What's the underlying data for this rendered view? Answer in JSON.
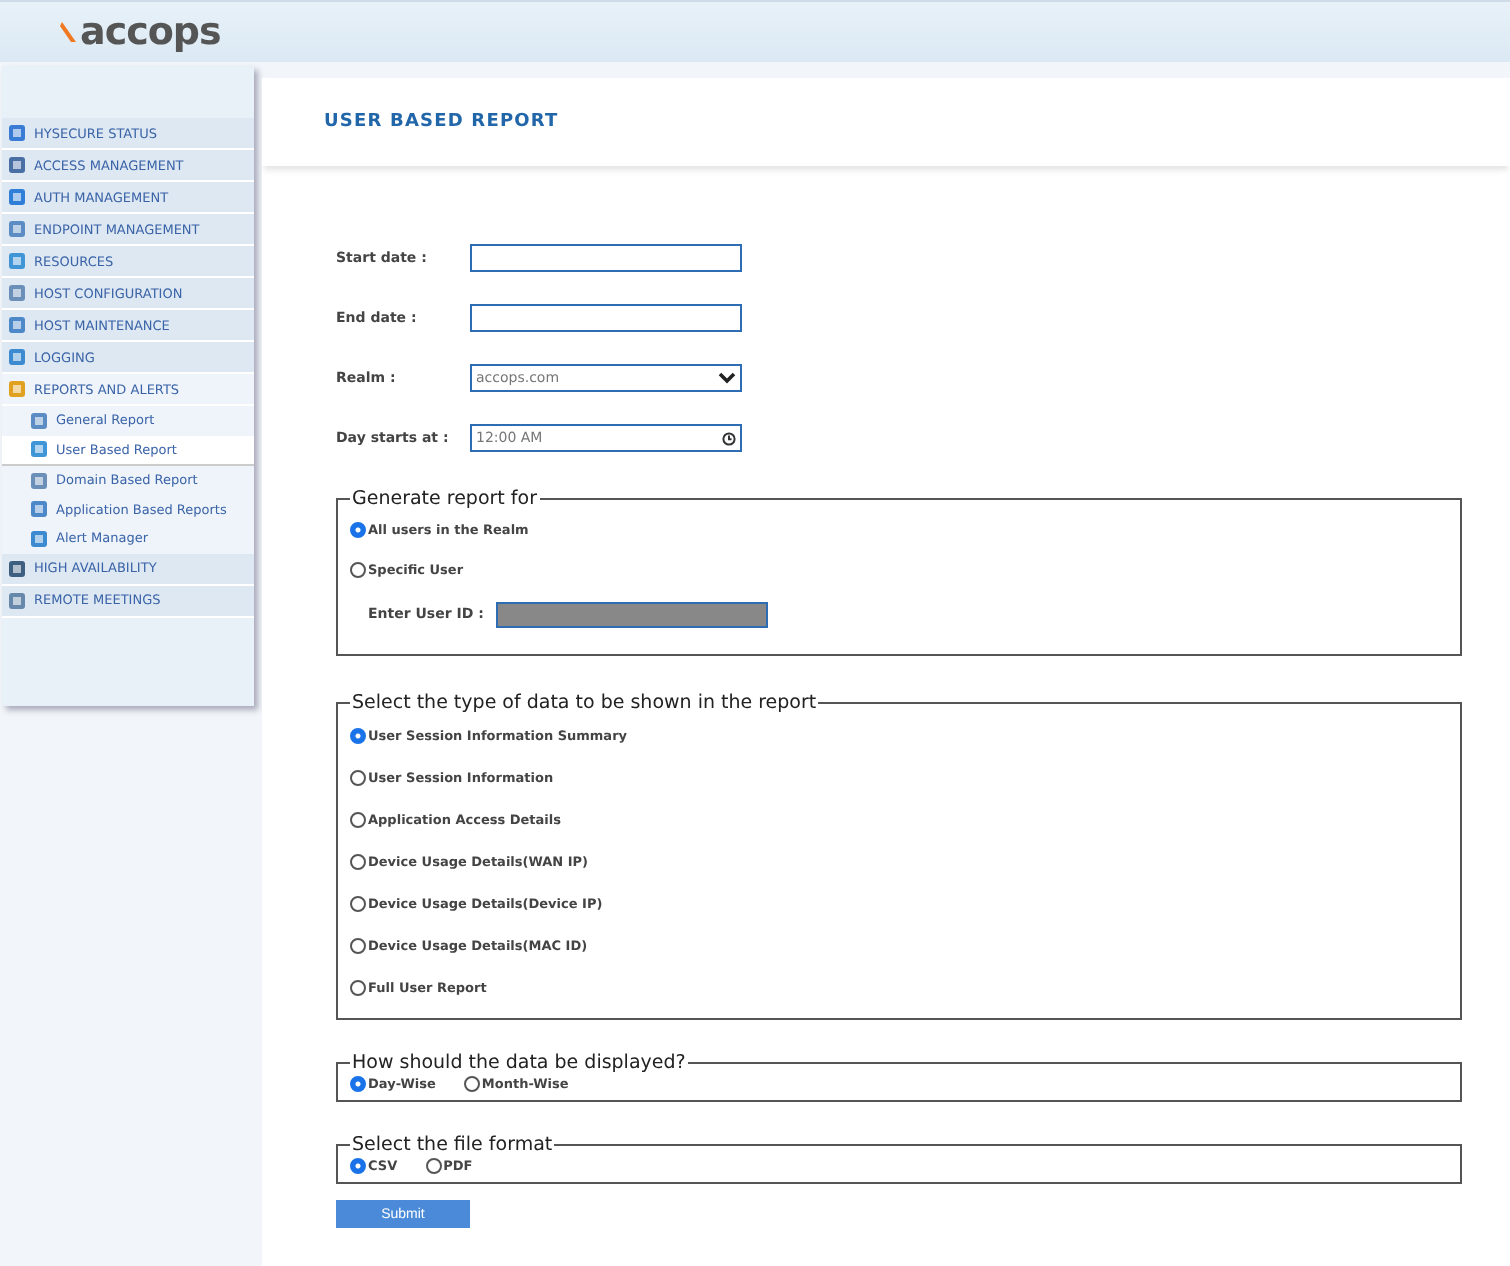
{
  "logo": "accops",
  "sidebar": {
    "items": [
      {
        "label": "HYSECURE STATUS",
        "expanded": false
      },
      {
        "label": "ACCESS MANAGEMENT",
        "expanded": false
      },
      {
        "label": "AUTH MANAGEMENT",
        "expanded": false
      },
      {
        "label": "ENDPOINT MANAGEMENT",
        "expanded": false
      },
      {
        "label": "RESOURCES",
        "expanded": false
      },
      {
        "label": "HOST CONFIGURATION",
        "expanded": false
      },
      {
        "label": "HOST MAINTENANCE",
        "expanded": false
      },
      {
        "label": "LOGGING",
        "expanded": false
      },
      {
        "label": "REPORTS AND ALERTS",
        "expanded": true,
        "children": [
          {
            "label": "General Report",
            "selected": false
          },
          {
            "label": "User Based Report",
            "selected": true
          },
          {
            "label": "Domain Based Report",
            "selected": false
          },
          {
            "label": "Application Based Reports",
            "selected": false
          },
          {
            "label": "Alert Manager",
            "selected": false
          }
        ]
      },
      {
        "label": "HIGH AVAILABILITY",
        "expanded": false
      },
      {
        "label": "REMOTE MEETINGS",
        "expanded": false
      }
    ]
  },
  "title": "USER BASED REPORT",
  "fields": [
    {
      "label": "Start date :",
      "kind": "text"
    },
    {
      "label": "End date :",
      "kind": "text"
    },
    {
      "label": "Realm :",
      "kind": "select",
      "value": "accops.com"
    },
    {
      "label": "Day starts at :",
      "kind": "time",
      "value": "12:00 AM"
    }
  ],
  "generate": {
    "legend": "Generate report for",
    "options": [
      {
        "label": "All users in the Realm",
        "selected": true
      },
      {
        "label": "Specific User",
        "selected": false
      }
    ],
    "user_id_label": "Enter User ID :"
  },
  "data_type": {
    "legend": "Select the type of data to be shown in the report",
    "options": [
      {
        "label": "User Session Information Summary",
        "selected": true
      },
      {
        "label": "User Session Information",
        "selected": false
      },
      {
        "label": "Application Access Details",
        "selected": false
      },
      {
        "label": "Device Usage Details(WAN IP)",
        "selected": false
      },
      {
        "label": "Device Usage Details(Device IP)",
        "selected": false
      },
      {
        "label": "Device Usage Details(MAC ID)",
        "selected": false
      },
      {
        "label": "Full User Report",
        "selected": false
      }
    ]
  },
  "display": {
    "legend": "How should the data be displayed?",
    "options": [
      {
        "label": "Day-Wise",
        "selected": true
      },
      {
        "label": "Month-Wise",
        "selected": false
      }
    ]
  },
  "format": {
    "legend": "Select the file format",
    "options": [
      {
        "label": "CSV",
        "selected": true
      },
      {
        "label": "PDF",
        "selected": false
      }
    ]
  },
  "submit": "Submit"
}
